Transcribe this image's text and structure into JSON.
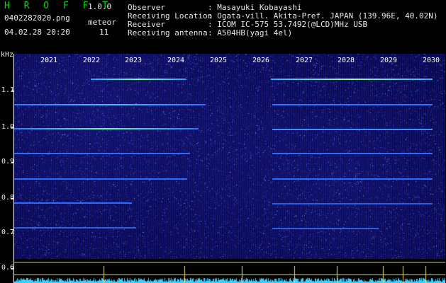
{
  "header": {
    "logo": "H R O F F T",
    "version": "1.0.0",
    "filename": "0402282020.png",
    "datetime": "04.02.28 20:20",
    "count_label": "meteor",
    "count_value": "11",
    "fields": [
      {
        "label": "Observer",
        "value": ": Masayuki Kobayashi"
      },
      {
        "label": "Receiving Location",
        "value": ": Ogata-vill. Akita-Pref. JAPAN (139.96E, 40.02N)"
      },
      {
        "label": "Receiver",
        "value": ": ICOM IC-575 53.7492(@LCD)MHz USB"
      },
      {
        "label": "Receiving antenna",
        "value": ": A504HB(yagi 4el)"
      }
    ]
  },
  "y_axis": {
    "unit": "kHz",
    "ticks": [
      "1.1",
      "1.0",
      "0.9",
      "0.8",
      "0.7",
      "0.6"
    ]
  },
  "x_axis": {
    "ticks": [
      "2021",
      "2022",
      "2023",
      "2024",
      "2025",
      "2026",
      "2027",
      "2028",
      "2029",
      "2030"
    ]
  },
  "colors": {
    "background": "#000000",
    "plot_bg": "#0a0a5c",
    "echo_line": "#3a7cff",
    "strong_echo": "#7dff9a",
    "logo": "#00e000",
    "text": "#e8e8e8"
  }
}
